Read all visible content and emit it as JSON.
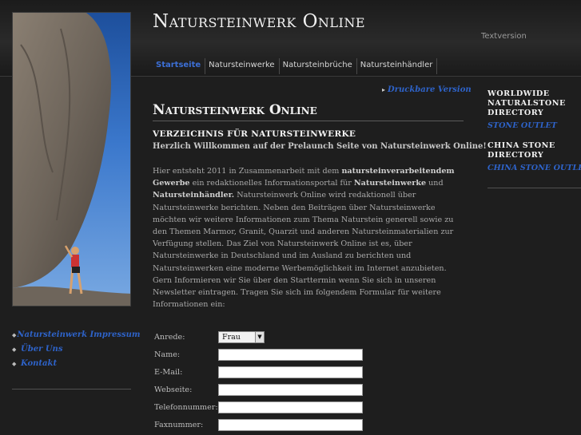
{
  "header": {
    "title": "Natursteinwerk Online",
    "textversion": "Textversion"
  },
  "nav": {
    "items": [
      "Startseite",
      "Natursteinwerke",
      "Natursteinbrüche",
      "Natursteinhändler"
    ]
  },
  "left_menu": {
    "items": [
      "Natursteinwerk Impressum",
      "Über Uns",
      "Kontakt"
    ]
  },
  "main": {
    "print_link": "Druckbare Version",
    "heading": "Natursteinwerk Online",
    "subheading": "VERZEICHNIS FÜR NATURSTEINWERKE",
    "welcome": "Herzlich Willkommen auf der Prelaunch Seite von Natursteinwerk Online!",
    "body": {
      "p1": "Hier entsteht 2011 in Zusammenarbeit mit dem ",
      "b1": "natursteinverarbeitendem Gewerbe",
      "p2": " ein redaktionelles Informationsportal für ",
      "b2": "Natursteinwerke",
      "p3": " und ",
      "b3": "Natursteinhändler.",
      "p4": " Natursteinwerk Online wird redaktionell über Natursteinwerke berichten. Neben den Beiträgen über Natursteinwerke möchten wir weitere Informationen zum Thema Naturstein generell sowie zu den Themen Marmor, Granit, Quarzit und anderen Natursteinmaterialien zur Verfügung stellen. Das Ziel von Natursteinwerk Online ist es, über Natursteinwerke in Deutschland und im Ausland zu berichten und Natursteinwerken eine moderne Werbemöglichkeit im Internet anzubieten. Gern Informieren wir Sie über den Starttermin wenn Sie sich in unseren Newsletter eintragen. Tragen Sie sich im folgendem Formular für weitere Informationen ein:"
    }
  },
  "form": {
    "anrede_label": "Anrede:",
    "anrede_value": "Frau",
    "name_label": "Name:",
    "email_label": "E-Mail:",
    "webseite_label": "Webseite:",
    "telefon_label": "Telefonnummer:",
    "fax_label": "Faxnummer:"
  },
  "right": {
    "block1_head": "WORLDWIDE NATURALSTONE DIRECTORY",
    "block1_link": "STONE OUTLET",
    "block2_head": "CHINA STONE DIRECTORY",
    "block2_link": "CHINA STONE OUTLET"
  },
  "colors": {
    "link_blue": "#2e63c9",
    "background": "#1e1e1e"
  }
}
